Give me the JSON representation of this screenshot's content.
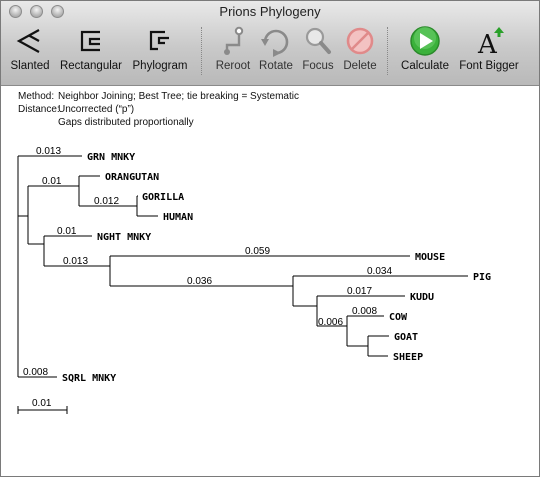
{
  "window": {
    "title": "Prions Phylogeny"
  },
  "toolbar": {
    "slanted": "Slanted",
    "rectangular": "Rectangular",
    "phylogram": "Phylogram",
    "reroot": "Reroot",
    "rotate": "Rotate",
    "focus": "Focus",
    "delete": "Delete",
    "calculate": "Calculate",
    "font_bigger": "Font Bigger"
  },
  "info": {
    "method_label": "Method:",
    "method_value": "Neighbor Joining; Best Tree; tie breaking = Systematic",
    "distance_label": "Distance:",
    "distance_value": "Uncorrected (“p”)",
    "gaps_value": "Gaps distributed proportionally"
  },
  "tree": {
    "leaves": {
      "grn_mnky": "GRN MNKY",
      "orangutan": "ORANGUTAN",
      "gorilla": "GORILLA",
      "human": "HUMAN",
      "nght_mnky": "NGHT MNKY",
      "mouse": "MOUSE",
      "pig": "PIG",
      "kudu": "KUDU",
      "cow": "COW",
      "goat": "GOAT",
      "sheep": "SHEEP",
      "sqrl_mnky": "SQRL MNKY"
    },
    "branch_lengths": {
      "grn_mnky": "0.013",
      "great_apes": "0.01",
      "gorilla_human": "0.012",
      "nght_mnky": "0.01",
      "laurasiatheria": "0.013",
      "mouse": "0.059",
      "ungulates": "0.036",
      "pig": "0.034",
      "kudu": "0.017",
      "cow": "0.008",
      "goat_sheep": "0.006",
      "sqrl_mnky": "0.008"
    },
    "scale_bar": "0.01"
  }
}
